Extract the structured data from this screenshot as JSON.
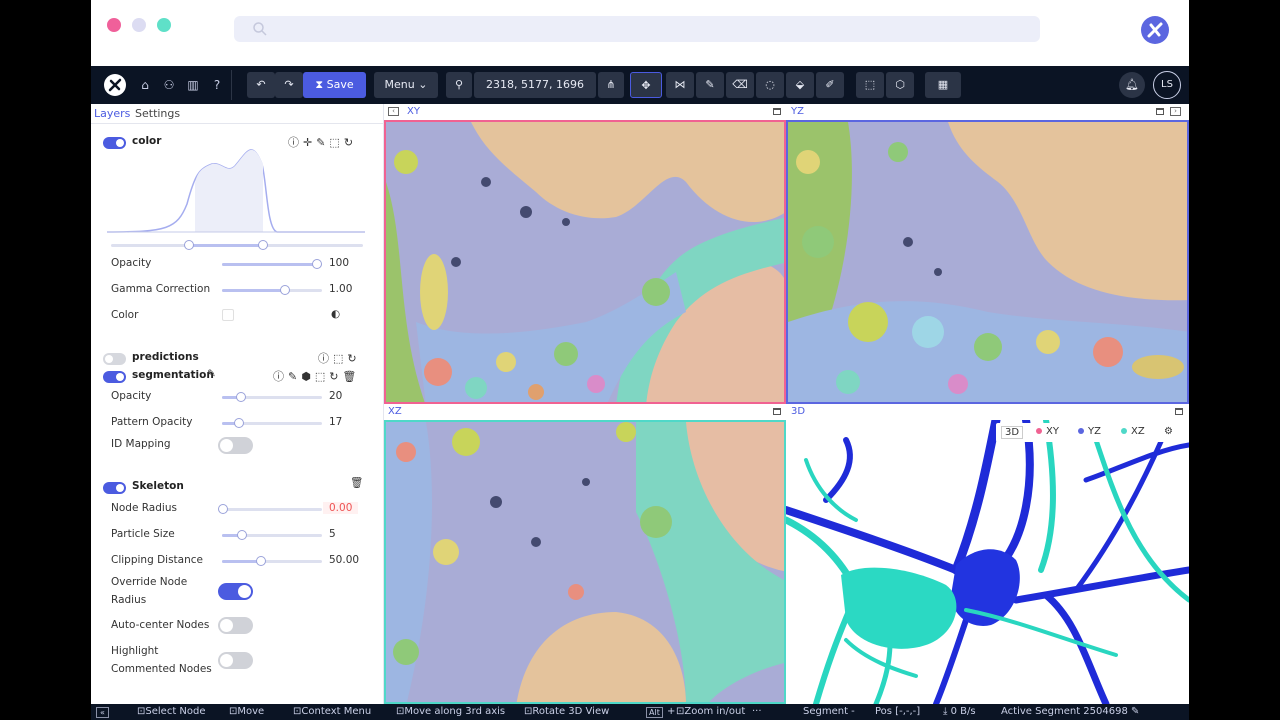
{
  "toolbar": {
    "save_label": "Save",
    "menu_label": "Menu",
    "position": "2318, 5177, 1696",
    "avatar_initials": "LS"
  },
  "tabs": [
    "Layers",
    "Settings"
  ],
  "layers": {
    "color": {
      "name": "color",
      "opacity_label": "Opacity",
      "opacity_value": "100",
      "gamma_label": "Gamma Correction",
      "gamma_value": "1.00",
      "color_label": "Color"
    },
    "predictions": {
      "name": "predictions"
    },
    "segmentation": {
      "name": "segmentation",
      "opacity_label": "Opacity",
      "opacity_value": "20",
      "pattern_label": "Pattern Opacity",
      "pattern_value": "17",
      "idmap_label": "ID Mapping"
    },
    "skeleton": {
      "name": "Skeleton",
      "node_radius_label": "Node Radius",
      "node_radius_value": "0.00",
      "particle_label": "Particle Size",
      "particle_value": "5",
      "clip_label": "Clipping Distance",
      "clip_value": "50.00",
      "override_label_1": "Override Node",
      "override_label_2": "Radius",
      "autocenter_label": "Auto-center Nodes",
      "highlight_label_1": "Highlight",
      "highlight_label_2": "Commented Nodes"
    }
  },
  "viewports": {
    "xy": "XY",
    "yz": "YZ",
    "xz": "XZ",
    "td": "3D",
    "legend": [
      "3D",
      "XY",
      "YZ",
      "XZ"
    ]
  },
  "colors": {
    "xy": "#f06292",
    "yz": "#5b66e0",
    "xz": "#4fd8c8",
    "accent": "#4b5be0",
    "toolbar": "#0b1424"
  },
  "status": {
    "select_node": "Select Node",
    "move": "Move",
    "context_menu": "Context Menu",
    "move_3rd": "Move along 3rd axis",
    "rotate": "Rotate 3D View",
    "alt": "Alt",
    "zoom": "Zoom in/out",
    "ellipsis": "···",
    "segment": "Segment -",
    "pos": "Pos [-,-,-]",
    "speed": "0 B/s",
    "active_segment": "Active Segment 2504698"
  }
}
